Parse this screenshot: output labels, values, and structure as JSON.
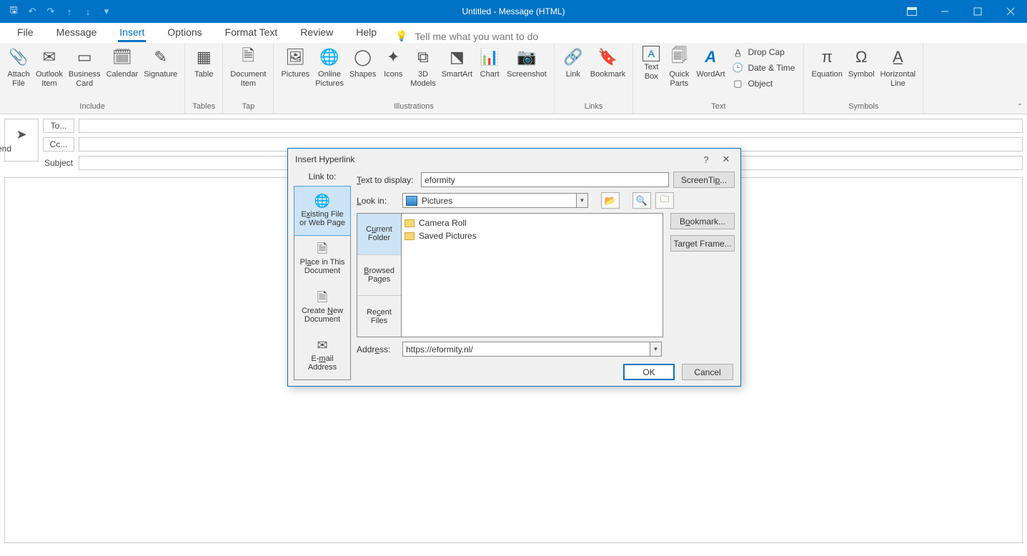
{
  "titlebar": {
    "title": "Untitled  -  Message (HTML)"
  },
  "tabs": {
    "file": "File",
    "message": "Message",
    "insert": "Insert",
    "options": "Options",
    "format": "Format Text",
    "review": "Review",
    "help": "Help",
    "tellme": "Tell me what you want to do"
  },
  "ribbon": {
    "include": {
      "label": "Include",
      "attach": "Attach\nFile",
      "outlook": "Outlook\nItem",
      "bizcard": "Business\nCard",
      "calendar": "Calendar",
      "signature": "Signature"
    },
    "tables": {
      "label": "Tables",
      "table": "Table"
    },
    "tap": {
      "label": "Tap",
      "docitem": "Document\nItem"
    },
    "illus": {
      "label": "Illustrations",
      "pictures": "Pictures",
      "online": "Online\nPictures",
      "shapes": "Shapes",
      "icons": "Icons",
      "models": "3D\nModels",
      "smartart": "SmartArt",
      "chart": "Chart",
      "screenshot": "Screenshot"
    },
    "links": {
      "label": "Links",
      "link": "Link",
      "bookmark": "Bookmark"
    },
    "text": {
      "label": "Text",
      "textbox": "Text\nBox",
      "quick": "Quick\nParts",
      "wordart": "WordArt",
      "dropcap": "Drop Cap",
      "datetime": "Date & Time",
      "object": "Object"
    },
    "symbols": {
      "label": "Symbols",
      "equation": "Equation",
      "symbol": "Symbol",
      "hline": "Horizontal\nLine"
    }
  },
  "compose": {
    "send": "Send",
    "to": "To...",
    "cc": "Cc...",
    "subject": "Subject"
  },
  "dialog": {
    "title": "Insert Hyperlink",
    "linkto_label": "Link to:",
    "side": {
      "existing_l1": "Existing File",
      "existing_l2": "or Web Page",
      "place_l1": "Place in This",
      "place_l2": "Document",
      "createnew_l1": "Create New",
      "createnew_l2": "Document",
      "email_l1": "E-mail",
      "email_l2": "Address"
    },
    "text_to_display_label": "Text to display:",
    "text_to_display_value": "eformity",
    "lookin_label": "Look in:",
    "lookin_value": "Pictures",
    "browser_side": {
      "current_l1": "Current",
      "current_l2": "Folder",
      "browsed_l1": "Browsed",
      "browsed_l2": "Pages",
      "recent_l1": "Recent",
      "recent_l2": "Files"
    },
    "files": [
      "Camera Roll",
      "Saved Pictures"
    ],
    "address_label": "Address:",
    "address_value": "https://eformity.nl/",
    "buttons": {
      "screentip": "ScreenTip...",
      "bookmark": "Bookmark...",
      "targetframe": "Target Frame...",
      "ok": "OK",
      "cancel": "Cancel"
    }
  }
}
